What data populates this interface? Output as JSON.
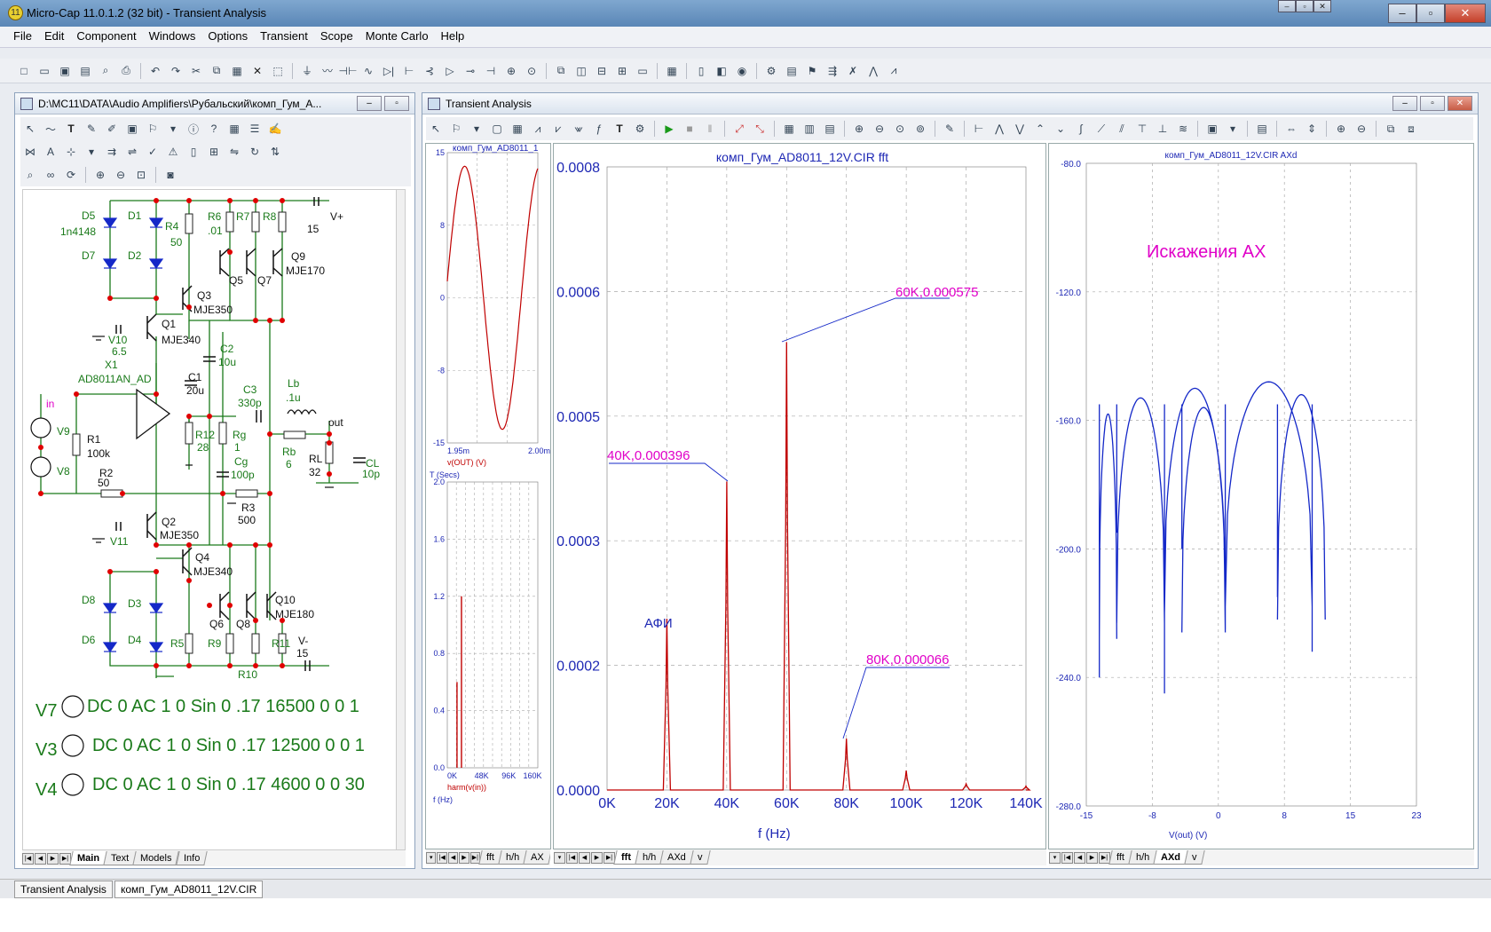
{
  "app": {
    "title": "Micro-Cap 11.0.1.2 (32 bit) - Transient Analysis",
    "caption_buttons": [
      "–",
      "▫",
      "✕"
    ]
  },
  "menu": [
    "File",
    "Edit",
    "Component",
    "Windows",
    "Options",
    "Transient",
    "Scope",
    "Monte Carlo",
    "Help"
  ],
  "schematic_window": {
    "title": "D:\\MC11\\DATA\\Audio Amplifiers\\Рубальский\\комп_Гум_А...",
    "tabs": [
      "Main",
      "Text",
      "Models",
      "Info"
    ],
    "active_tab": "Main",
    "labels": {
      "D5": "D5",
      "d1n4148": "1n4148",
      "D1": "D1",
      "D7": "D7",
      "D2": "D2",
      "R4": "R4",
      "R4v": "50",
      "R6": "R6",
      "R6v": ".01",
      "R7": "R7",
      "R8": "R8",
      "Vp": "V+",
      "Vpv": "15",
      "Q9": "Q9",
      "Q9m": "MJE170",
      "Q5": "Q5",
      "Q7": "Q7",
      "Q3": "Q3",
      "Q3m": "MJE350",
      "Q1": "Q1",
      "Q1m": "MJE340",
      "V10": "V10",
      "V10v": "6.5",
      "C2": "C2",
      "C2v": "10u",
      "X1": "X1",
      "X1m": "AD8011AN_AD",
      "C1": "C1",
      "C1v": "20u",
      "C3": "C3",
      "C3v": "330p",
      "Lb": "Lb",
      "Lbv": ".1u",
      "in": "in",
      "V9": "V9",
      "V8": "V8",
      "R1": "R1",
      "R1v": "100k",
      "R12": "R12",
      "R12v": "28",
      "Rg": "Rg",
      "Rgv": "1",
      "out": "out",
      "Rb": "Rb",
      "Rbv": "6",
      "RL": "RL",
      "RLv": "32",
      "CL": "CL",
      "CLv": "10p",
      "Cg": "Cg",
      "Cgv": "100p",
      "R2": "R2",
      "R2v": "50",
      "R3": "R3",
      "R3v": "500",
      "Q2": "Q2",
      "Q2m": "MJE350",
      "V11": "V11",
      "Q4": "Q4",
      "Q4m": "MJE340",
      "D8": "D8",
      "D3": "D3",
      "D6": "D6",
      "D4": "D4",
      "R5": "R5",
      "R9": "R9",
      "R11": "R11",
      "Q6": "Q6",
      "Q8": "Q8",
      "Q10": "Q10",
      "Q10m": "MJE180",
      "Vm": "V-",
      "Vmv": "15",
      "R10": "R10"
    },
    "sources": [
      {
        "name": "V7",
        "spec": "DC 0 AC 1 0 Sin 0 .17 16500 0 0 1"
      },
      {
        "name": "V3",
        "spec": "DC 0 AC 1 0 Sin 0 .17 12500 0 0 1"
      },
      {
        "name": "V4",
        "spec": "DC 0 AC 1 0 Sin 0 .17 4600 0 0 30"
      }
    ]
  },
  "analysis_window": {
    "title": "Transient Analysis"
  },
  "status_tabs": [
    "Transient Analysis",
    "комп_Гум_AD8011_12V.CIR"
  ],
  "colors": {
    "trace_red": "#c00000",
    "trace_blue": "#1428c8",
    "label_magenta": "#e000c8",
    "axis_blue": "#1e28b4",
    "schem_green": "#1a7a1a",
    "node_red": "#e00000"
  },
  "chart_data": [
    {
      "type": "line",
      "title": "комп_Гум_AD8011_1",
      "x_ticks": [
        "1.95m",
        "2.00m"
      ],
      "xlabel": "T (Secs)",
      "ylabel": "v(OUT) (V)",
      "y_ticks": [
        "15",
        "8",
        "0",
        "-8",
        "-15"
      ],
      "xlim": [
        0.00195,
        0.002
      ],
      "ylim": [
        -15,
        15
      ],
      "series": [
        {
          "name": "v(OUT) (V)",
          "x": [
            0.00195,
            0.001956,
            0.001962,
            0.001968,
            0.001974,
            0.00198,
            0.001986,
            0.001992,
            0.001998,
            0.002
          ],
          "y": [
            0,
            10,
            13.6,
            10.5,
            1.5,
            -8,
            -13.6,
            -11,
            -3,
            1
          ]
        }
      ]
    },
    {
      "type": "bar",
      "xlabel": "f (Hz)",
      "ylabel": "harm(v(in))",
      "x_ticks": [
        "0K",
        "48K",
        "96K",
        "160K"
      ],
      "y_ticks": [
        "2.0",
        "1.6",
        "1.2",
        "0.8",
        "0.4",
        "0.0"
      ],
      "ylim": [
        0,
        2.0
      ],
      "x": [
        4600,
        12500,
        16500
      ],
      "values": [
        0.6,
        1.2,
        0.0
      ]
    },
    {
      "type": "line",
      "title": "комп_Гум_AD8011_12V.CIR fft",
      "xlabel": "f (Hz)",
      "x_ticks": [
        "0K",
        "20K",
        "40K",
        "60K",
        "80K",
        "100K",
        "120K",
        "140K"
      ],
      "y_ticks": [
        "0.0008",
        "0.0006",
        "0.0005",
        "0.0003",
        "0.0002",
        "0.0000"
      ],
      "xlim": [
        0,
        140000
      ],
      "ylim": [
        0,
        0.0008
      ],
      "annotations": [
        "40K,0.000396",
        "60K,0.000575",
        "80K,0.000066",
        "АФИ"
      ],
      "peaks": [
        {
          "x": 20000,
          "y": 0.00022
        },
        {
          "x": 40000,
          "y": 0.000396
        },
        {
          "x": 60000,
          "y": 0.000575
        },
        {
          "x": 80000,
          "y": 6.6e-05
        },
        {
          "x": 100000,
          "y": 2.5e-05
        },
        {
          "x": 120000,
          "y": 8e-06
        },
        {
          "x": 140000,
          "y": 5e-06
        }
      ]
    },
    {
      "type": "line",
      "title": "комп_Гум_AD8011_12V.CIR AXd",
      "annotation": "Искажения АХ",
      "xlabel": "V(out) (V)",
      "x_ticks": [
        "-15",
        "-8",
        "0",
        "8",
        "15",
        "23"
      ],
      "y_ticks": [
        "-80.0",
        "-120.0",
        "-160.0",
        "-200.0",
        "-240.0",
        "-280.0"
      ],
      "xlim": [
        -15,
        23
      ],
      "ylim": [
        -280,
        -80
      ],
      "series": [
        {
          "name": "AXd",
          "x": [
            -13.5,
            -12,
            -9,
            -6,
            -4,
            -2,
            0,
            3,
            6,
            8,
            10,
            12.5
          ],
          "y": [
            -157,
            -190,
            -153,
            -150,
            -200,
            -155,
            -150,
            -215,
            -150,
            -148,
            -152,
            -154
          ]
        }
      ]
    }
  ],
  "tab_sets": {
    "left_plot": [
      "fft",
      "h/h",
      "AX"
    ],
    "fft_plot": [
      "fft",
      "h/h",
      "AXd",
      "v"
    ],
    "ax_plot": [
      "fft",
      "h/h",
      "AXd",
      "v"
    ]
  },
  "active_tabs": {
    "left_plot": "fft",
    "fft_plot": "fft",
    "ax_plot": "AXd"
  }
}
